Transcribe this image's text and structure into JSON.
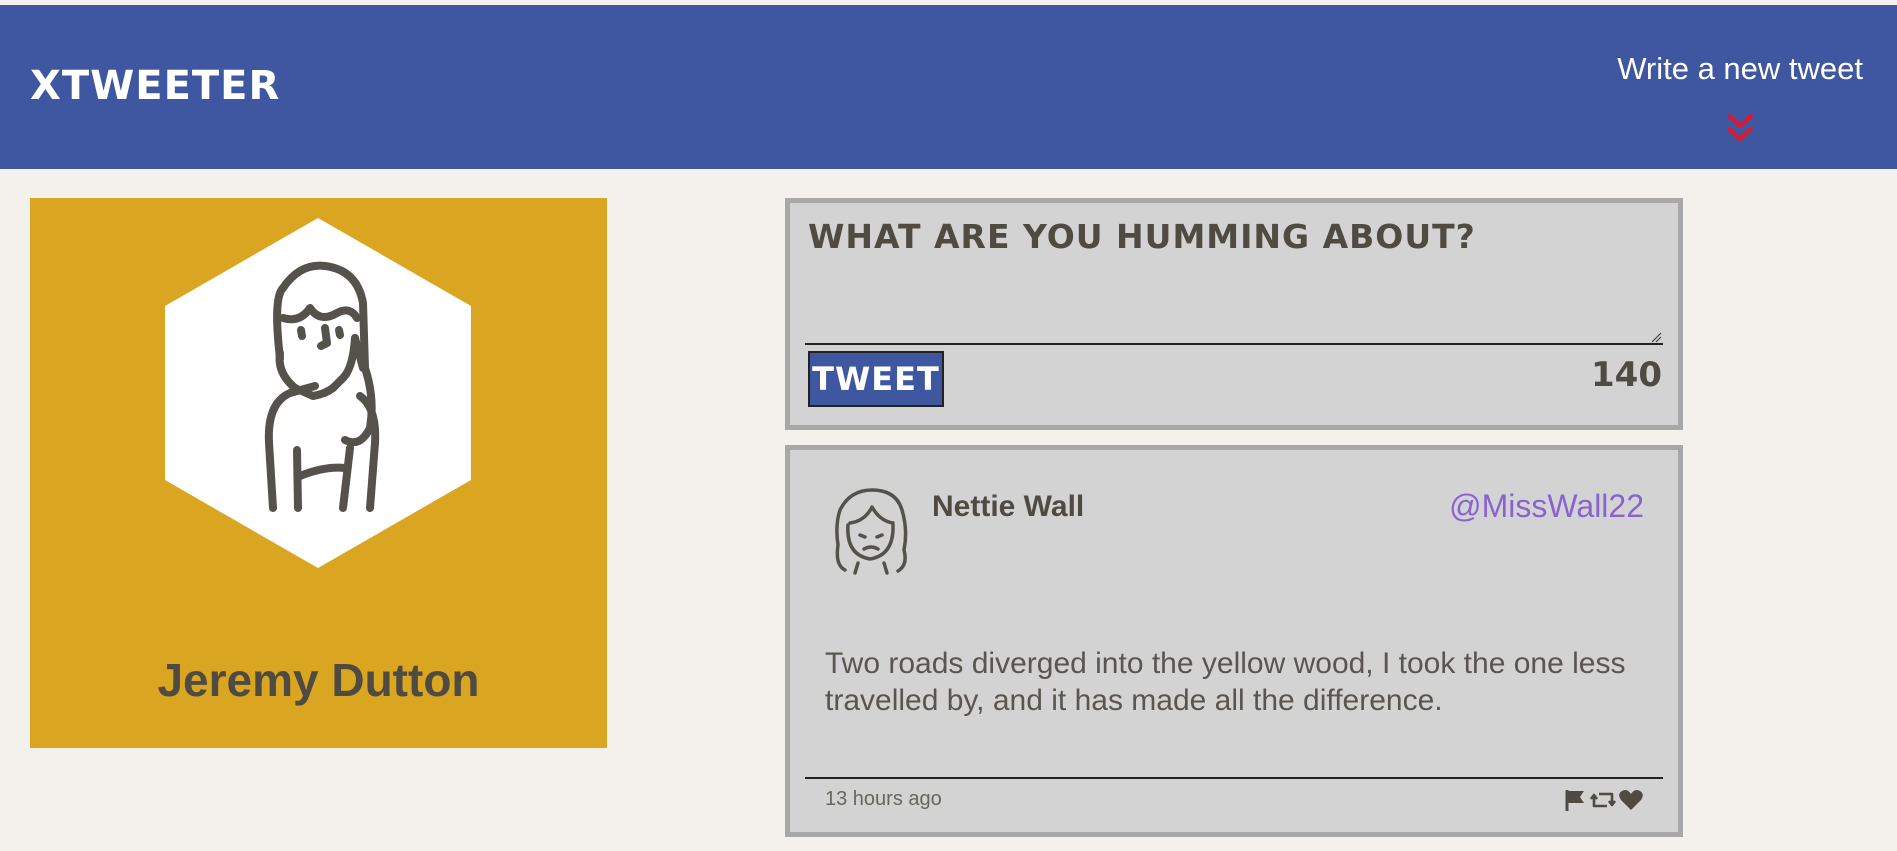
{
  "app": {
    "title": "xtweeter"
  },
  "nav": {
    "compose_label": "Write a new tweet",
    "compose_icon": "double-chevron-down-icon",
    "compose_icon_color": "#e0182d",
    "background": "#3f56a0"
  },
  "profile": {
    "name": "Jeremy Dutton",
    "avatar_icon": "user-avatar-icon",
    "card_color": "#daa520"
  },
  "compose": {
    "placeholder": "What are you humming about?",
    "value": "",
    "button_label": "Tweet",
    "counter": "140"
  },
  "tweets": [
    {
      "author": "Nettie Wall",
      "handle": "@MissWall22",
      "avatar_icon": "user-avatar-icon",
      "text": "Two roads diverged into the yellow wood, I took the one less travelled by, and it has made all the difference.",
      "time": "13 hours ago",
      "actions": [
        "flag-icon",
        "retweet-icon",
        "heart-icon"
      ]
    }
  ]
}
